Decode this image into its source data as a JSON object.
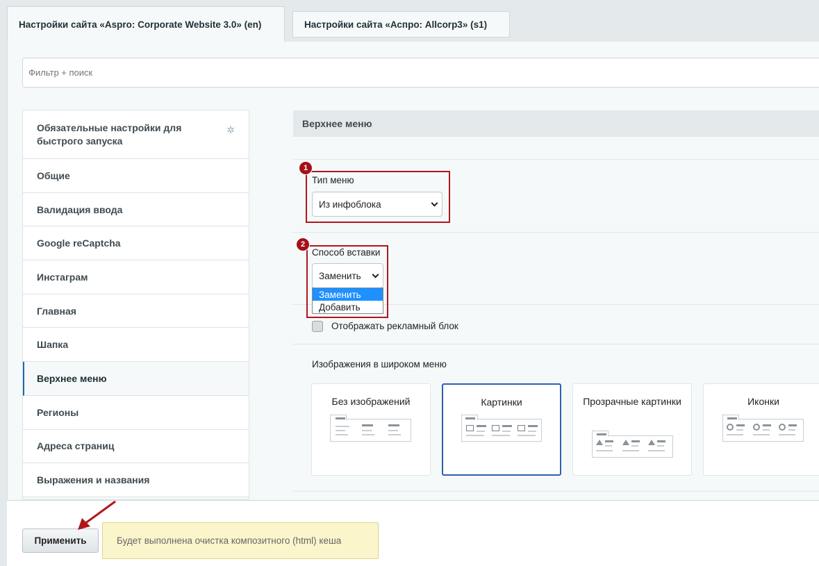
{
  "tabs": [
    {
      "label": "Настройки сайта «Aspro: Corporate Website 3.0» (en)",
      "active": true
    },
    {
      "label": "Настройки сайта «Аспро: Allcorp3» (s1)",
      "active": false
    }
  ],
  "filter": {
    "placeholder": "Фильтр + поиск"
  },
  "sidebar": {
    "items": [
      {
        "label": "Обязательные настройки для быстрого запуска"
      },
      {
        "label": "Общие"
      },
      {
        "label": "Валидация ввода"
      },
      {
        "label": "Google reCaptcha"
      },
      {
        "label": "Инстаграм"
      },
      {
        "label": "Главная"
      },
      {
        "label": "Шапка"
      },
      {
        "label": "Верхнее меню"
      },
      {
        "label": "Регионы"
      },
      {
        "label": "Адреса страниц"
      },
      {
        "label": "Выражения и названия"
      }
    ],
    "active_index": 7
  },
  "section": {
    "title": "Верхнее меню"
  },
  "menu_type": {
    "label": "Тип меню",
    "value": "Из инфоблока",
    "badge": "1"
  },
  "insert_method": {
    "label": "Способ вставки",
    "value": "Заменить",
    "badge": "2",
    "options": [
      "Заменить",
      "Добавить"
    ]
  },
  "ad_block": {
    "label": "Отображать рекламный блок",
    "checked": false
  },
  "wide_menu_images": {
    "label": "Изображения в широком меню",
    "cards": [
      {
        "title": "Без изображений",
        "icon": "no-images-icon"
      },
      {
        "title": "Картинки",
        "icon": "pictures-icon",
        "selected": true
      },
      {
        "title": "Прозрачные картинки",
        "icon": "transparent-pictures-icon"
      },
      {
        "title": "Иконки",
        "icon": "icons-icon"
      }
    ]
  },
  "footer": {
    "apply_label": "Применить",
    "notice": "Будет выполнена очистка композитного (html) кеша"
  },
  "colors": {
    "accent": "#2067b0",
    "highlight_box": "#b0161b",
    "badge": "#a3111a",
    "selected_option": "#1e90ff"
  }
}
